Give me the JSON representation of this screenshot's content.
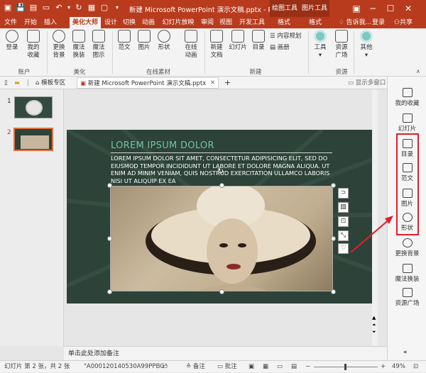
{
  "titlebar": {
    "doc_title": "新建 Microsoft PowerPoint 演示文稿.pptx - P...",
    "context_tab1": "绘图工具",
    "context_tab2": "图片工具",
    "login": "登录",
    "share": "共享",
    "tell_me": "告诉我..."
  },
  "tabs": [
    "文件",
    "开始",
    "插入",
    "美化大师",
    "设计",
    "切换",
    "动画",
    "幻灯片放映",
    "审阅",
    "视图",
    "开发工具",
    "格式",
    "格式"
  ],
  "ribbon": {
    "account": {
      "login": "登录",
      "favorites_l1": "我的",
      "favorites_l2": "收藏",
      "label": "账户"
    },
    "beautify": {
      "change_bg_l1": "更换",
      "change_bg_l2": "背景",
      "magic_l1": "魔法",
      "magic_l2": "换装",
      "magic_fig_l1": "魔法",
      "magic_fig_l2": "图示",
      "label": "美化"
    },
    "online": {
      "template": "范文",
      "image": "图片",
      "shape": "形状",
      "anim_l1": "在线",
      "anim_l2": "动画",
      "label": "在线素材"
    },
    "new": {
      "new_doc_l1": "新建",
      "new_doc_l2": "文档",
      "slide": "幻灯片",
      "toc": "目录",
      "content_plan": "内容规划",
      "album": "画册",
      "label": "新建"
    },
    "tools": {
      "tools": "工具",
      "resource_l1": "资源",
      "resource_l2": "广场",
      "label": "资源",
      "other": "其他"
    }
  },
  "filetabs": {
    "template_zone": "模板专区",
    "doc_tab": "新建 Microsoft PowerPoint 演示文稿.pptx",
    "show_multi": "显示多窗口"
  },
  "slides_panel": {
    "nums": [
      "1",
      "2"
    ]
  },
  "slide": {
    "heading": "LOREM IPSUM DOLOR",
    "body": "LOREM IPSUM DOLOR SIT AMET, CONSECTETUR ADIPISICING ELIT, SED DO EIUSMOD TEMPOR INCIDIDUNT UT LABORE ET DOLORE MAGNA ALIQUA. UT ENIM AD MINIM VENIAM, QUIS NOSTRUD EXERCITATION ULLAMCO LABORIS NISI UT ALIQUIP EX EA"
  },
  "right_panel": {
    "favorites": "我的收藏",
    "slide": "幻灯片",
    "toc": "目录",
    "template": "范文",
    "image": "图片",
    "shape": "形状",
    "change_bg": "更换背景",
    "magic": "魔法换装",
    "resource": "资源广场"
  },
  "notes": {
    "placeholder": "单击此处添加备注"
  },
  "status": {
    "slide_info": "幻灯片 第 2 张，共 2 张",
    "id": "\"A000120140530A99PPBG\"",
    "notes": "备注",
    "comments": "批注",
    "zoom": "49%"
  },
  "colors": {
    "accent": "#b83b1d",
    "slide_bg": "#2d4238",
    "highlight": "#e0202c",
    "heading": "#6fc3a2"
  }
}
